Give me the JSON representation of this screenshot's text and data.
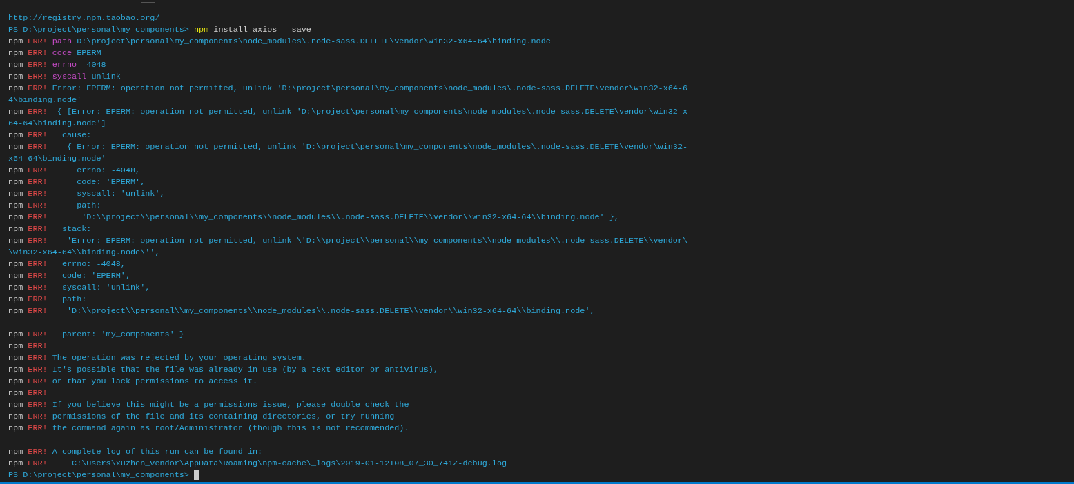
{
  "terminal": {
    "cursor": true,
    "blocks": [
      [
        {
          "segments": [
            {
              "kind": "output",
              "text": "http://registry.npm.taobao.org/"
            }
          ]
        },
        {
          "segments": [
            {
              "kind": "output",
              "text": "PS D:\\project\\personal\\my_components> "
            },
            {
              "kind": "command",
              "text": "npm"
            },
            {
              "kind": "plain",
              "text": " install axios --save"
            }
          ]
        },
        {
          "segments": [
            {
              "kind": "plain",
              "text": "npm "
            },
            {
              "kind": "error",
              "text": "ERR!"
            },
            {
              "kind": "keyword",
              "text": " path"
            },
            {
              "kind": "output",
              "text": " D:\\project\\personal\\my_components\\node_modules\\.node-sass.DELETE\\vendor\\win32-x64-64\\binding.node"
            }
          ]
        },
        {
          "segments": [
            {
              "kind": "plain",
              "text": "npm "
            },
            {
              "kind": "error",
              "text": "ERR!"
            },
            {
              "kind": "keyword",
              "text": " code"
            },
            {
              "kind": "output",
              "text": " EPERM"
            }
          ]
        },
        {
          "segments": [
            {
              "kind": "plain",
              "text": "npm "
            },
            {
              "kind": "error",
              "text": "ERR!"
            },
            {
              "kind": "keyword",
              "text": " errno"
            },
            {
              "kind": "output",
              "text": " -4048"
            }
          ]
        },
        {
          "segments": [
            {
              "kind": "plain",
              "text": "npm "
            },
            {
              "kind": "error",
              "text": "ERR!"
            },
            {
              "kind": "keyword",
              "text": " syscall"
            },
            {
              "kind": "output",
              "text": " unlink"
            }
          ]
        },
        {
          "segments": [
            {
              "kind": "plain",
              "text": "npm "
            },
            {
              "kind": "error",
              "text": "ERR!"
            },
            {
              "kind": "output",
              "text": " Error: EPERM: operation not permitted, unlink 'D:\\project\\personal\\my_components\\node_modules\\.node-sass.DELETE\\vendor\\win32-x64-6"
            }
          ]
        },
        {
          "segments": [
            {
              "kind": "output",
              "text": "4\\binding.node'"
            }
          ]
        },
        {
          "segments": [
            {
              "kind": "plain",
              "text": "npm "
            },
            {
              "kind": "error",
              "text": "ERR!"
            },
            {
              "kind": "output",
              "text": "  { [Error: EPERM: operation not permitted, unlink 'D:\\project\\personal\\my_components\\node_modules\\.node-sass.DELETE\\vendor\\win32-x"
            }
          ]
        },
        {
          "segments": [
            {
              "kind": "output",
              "text": "64-64\\binding.node']"
            }
          ]
        },
        {
          "segments": [
            {
              "kind": "plain",
              "text": "npm "
            },
            {
              "kind": "error",
              "text": "ERR!"
            },
            {
              "kind": "output",
              "text": "   cause:"
            }
          ]
        },
        {
          "segments": [
            {
              "kind": "plain",
              "text": "npm "
            },
            {
              "kind": "error",
              "text": "ERR!"
            },
            {
              "kind": "output",
              "text": "    { Error: EPERM: operation not permitted, unlink 'D:\\project\\personal\\my_components\\node_modules\\.node-sass.DELETE\\vendor\\win32-"
            }
          ]
        },
        {
          "segments": [
            {
              "kind": "output",
              "text": "x64-64\\binding.node'"
            }
          ]
        },
        {
          "segments": [
            {
              "kind": "plain",
              "text": "npm "
            },
            {
              "kind": "error",
              "text": "ERR!"
            },
            {
              "kind": "output",
              "text": "      errno: -4048,"
            }
          ]
        },
        {
          "segments": [
            {
              "kind": "plain",
              "text": "npm "
            },
            {
              "kind": "error",
              "text": "ERR!"
            },
            {
              "kind": "output",
              "text": "      code: 'EPERM',"
            }
          ]
        },
        {
          "segments": [
            {
              "kind": "plain",
              "text": "npm "
            },
            {
              "kind": "error",
              "text": "ERR!"
            },
            {
              "kind": "output",
              "text": "      syscall: 'unlink',"
            }
          ]
        },
        {
          "segments": [
            {
              "kind": "plain",
              "text": "npm "
            },
            {
              "kind": "error",
              "text": "ERR!"
            },
            {
              "kind": "output",
              "text": "      path:"
            }
          ]
        },
        {
          "segments": [
            {
              "kind": "plain",
              "text": "npm "
            },
            {
              "kind": "error",
              "text": "ERR!"
            },
            {
              "kind": "output",
              "text": "       'D:\\\\project\\\\personal\\\\my_components\\\\node_modules\\\\.node-sass.DELETE\\\\vendor\\\\win32-x64-64\\\\binding.node' },"
            }
          ]
        },
        {
          "segments": [
            {
              "kind": "plain",
              "text": "npm "
            },
            {
              "kind": "error",
              "text": "ERR!"
            },
            {
              "kind": "output",
              "text": "   stack:"
            }
          ]
        },
        {
          "segments": [
            {
              "kind": "plain",
              "text": "npm "
            },
            {
              "kind": "error",
              "text": "ERR!"
            },
            {
              "kind": "output",
              "text": "    'Error: EPERM: operation not permitted, unlink \\'D:\\\\project\\\\personal\\\\my_components\\\\node_modules\\\\.node-sass.DELETE\\\\vendor\\"
            }
          ]
        },
        {
          "segments": [
            {
              "kind": "output",
              "text": "\\win32-x64-64\\\\binding.node\\'',"
            }
          ]
        },
        {
          "segments": [
            {
              "kind": "plain",
              "text": "npm "
            },
            {
              "kind": "error",
              "text": "ERR!"
            },
            {
              "kind": "output",
              "text": "   errno: -4048,"
            }
          ]
        },
        {
          "segments": [
            {
              "kind": "plain",
              "text": "npm "
            },
            {
              "kind": "error",
              "text": "ERR!"
            },
            {
              "kind": "output",
              "text": "   code: 'EPERM',"
            }
          ]
        },
        {
          "segments": [
            {
              "kind": "plain",
              "text": "npm "
            },
            {
              "kind": "error",
              "text": "ERR!"
            },
            {
              "kind": "output",
              "text": "   syscall: 'unlink',"
            }
          ]
        },
        {
          "segments": [
            {
              "kind": "plain",
              "text": "npm "
            },
            {
              "kind": "error",
              "text": "ERR!"
            },
            {
              "kind": "output",
              "text": "   path:"
            }
          ]
        },
        {
          "segments": [
            {
              "kind": "plain",
              "text": "npm "
            },
            {
              "kind": "error",
              "text": "ERR!"
            },
            {
              "kind": "output",
              "text": "    'D:\\\\project\\\\personal\\\\my_components\\\\node_modules\\\\.node-sass.DELETE\\\\vendor\\\\win32-x64-64\\\\binding.node',"
            }
          ]
        }
      ],
      [
        {
          "segments": [
            {
              "kind": "plain",
              "text": "npm "
            },
            {
              "kind": "error",
              "text": "ERR!"
            },
            {
              "kind": "output",
              "text": "   parent: 'my_components' }"
            }
          ]
        },
        {
          "segments": [
            {
              "kind": "plain",
              "text": "npm "
            },
            {
              "kind": "error",
              "text": "ERR!"
            }
          ]
        },
        {
          "segments": [
            {
              "kind": "plain",
              "text": "npm "
            },
            {
              "kind": "error",
              "text": "ERR!"
            },
            {
              "kind": "output",
              "text": " The operation was rejected by your operating system."
            }
          ]
        },
        {
          "segments": [
            {
              "kind": "plain",
              "text": "npm "
            },
            {
              "kind": "error",
              "text": "ERR!"
            },
            {
              "kind": "output",
              "text": " It's possible that the file was already in use (by a text editor or antivirus),"
            }
          ]
        },
        {
          "segments": [
            {
              "kind": "plain",
              "text": "npm "
            },
            {
              "kind": "error",
              "text": "ERR!"
            },
            {
              "kind": "output",
              "text": " or that you lack permissions to access it."
            }
          ]
        },
        {
          "segments": [
            {
              "kind": "plain",
              "text": "npm "
            },
            {
              "kind": "error",
              "text": "ERR!"
            }
          ]
        },
        {
          "segments": [
            {
              "kind": "plain",
              "text": "npm "
            },
            {
              "kind": "error",
              "text": "ERR!"
            },
            {
              "kind": "output",
              "text": " If you believe this might be a permissions issue, please double-check the"
            }
          ]
        },
        {
          "segments": [
            {
              "kind": "plain",
              "text": "npm "
            },
            {
              "kind": "error",
              "text": "ERR!"
            },
            {
              "kind": "output",
              "text": " permissions of the file and its containing directories, or try running"
            }
          ]
        },
        {
          "segments": [
            {
              "kind": "plain",
              "text": "npm "
            },
            {
              "kind": "error",
              "text": "ERR!"
            },
            {
              "kind": "output",
              "text": " the command again as root/Administrator (though this is not recommended)."
            }
          ]
        }
      ],
      [
        {
          "segments": [
            {
              "kind": "plain",
              "text": "npm "
            },
            {
              "kind": "error",
              "text": "ERR!"
            },
            {
              "kind": "output",
              "text": " A complete log of this run can be found in:"
            }
          ]
        },
        {
          "segments": [
            {
              "kind": "plain",
              "text": "npm "
            },
            {
              "kind": "error",
              "text": "ERR!"
            },
            {
              "kind": "output",
              "text": "     C:\\Users\\xuzhen_vendor\\AppData\\Roaming\\npm-cache\\_logs\\2019-01-12T08_07_30_741Z-debug.log"
            }
          ]
        },
        {
          "segments": [
            {
              "kind": "output",
              "text": "PS D:\\project\\personal\\my_components> "
            }
          ]
        }
      ]
    ]
  }
}
